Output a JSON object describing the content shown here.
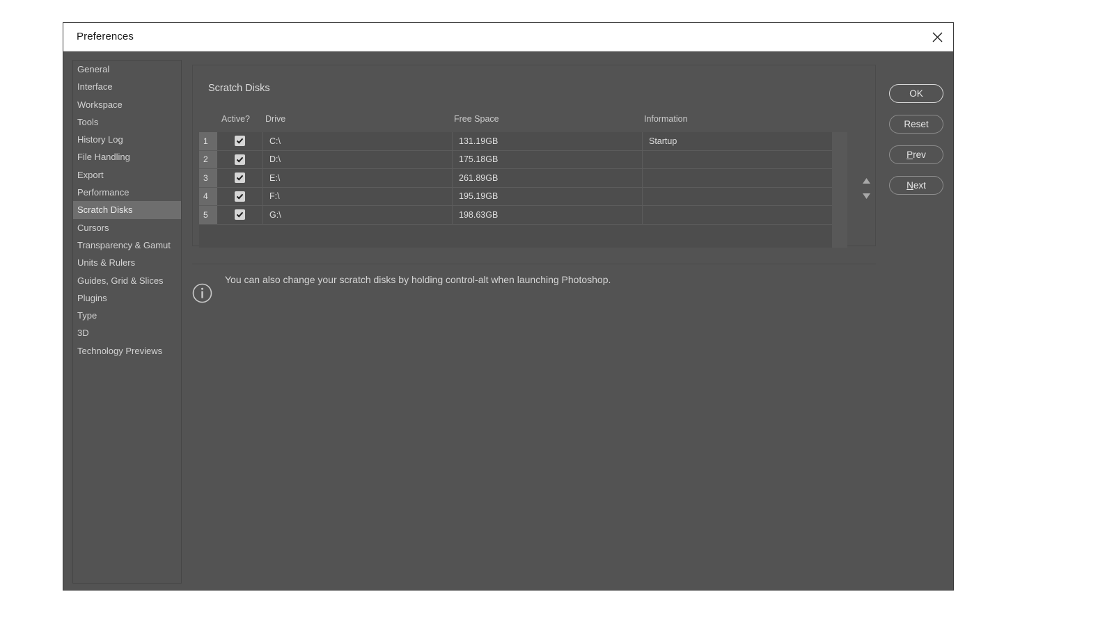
{
  "window": {
    "title": "Preferences",
    "close_icon": "close-icon"
  },
  "sidebar": {
    "items": [
      {
        "label": "General",
        "selected": false
      },
      {
        "label": "Interface",
        "selected": false
      },
      {
        "label": "Workspace",
        "selected": false
      },
      {
        "label": "Tools",
        "selected": false
      },
      {
        "label": "History Log",
        "selected": false
      },
      {
        "label": "File Handling",
        "selected": false
      },
      {
        "label": "Export",
        "selected": false
      },
      {
        "label": "Performance",
        "selected": false
      },
      {
        "label": "Scratch Disks",
        "selected": true
      },
      {
        "label": "Cursors",
        "selected": false
      },
      {
        "label": "Transparency & Gamut",
        "selected": false
      },
      {
        "label": "Units & Rulers",
        "selected": false
      },
      {
        "label": "Guides, Grid & Slices",
        "selected": false
      },
      {
        "label": "Plugins",
        "selected": false
      },
      {
        "label": "Type",
        "selected": false
      },
      {
        "label": "3D",
        "selected": false
      },
      {
        "label": "Technology Previews",
        "selected": false
      }
    ]
  },
  "panel": {
    "group_title": "Scratch Disks",
    "columns": {
      "active": "Active?",
      "drive": "Drive",
      "free_space": "Free Space",
      "information": "Information"
    },
    "rows": [
      {
        "index": "1",
        "active": true,
        "drive": "C:\\",
        "free_space": "131.19GB",
        "information": "Startup"
      },
      {
        "index": "2",
        "active": true,
        "drive": "D:\\",
        "free_space": "175.18GB",
        "information": ""
      },
      {
        "index": "3",
        "active": true,
        "drive": "E:\\",
        "free_space": "261.89GB",
        "information": ""
      },
      {
        "index": "4",
        "active": true,
        "drive": "F:\\",
        "free_space": "195.19GB",
        "information": ""
      },
      {
        "index": "5",
        "active": true,
        "drive": "G:\\",
        "free_space": "198.63GB",
        "information": ""
      }
    ],
    "reorder": {
      "up_icon": "arrow-up-icon",
      "down_icon": "arrow-down-icon"
    },
    "note": {
      "icon": "info-icon",
      "text": "You can also change your scratch disks by holding control-alt when launching Photoshop."
    }
  },
  "buttons": {
    "ok": "OK",
    "reset": "Reset",
    "prev_accel": "P",
    "prev_rest": "rev",
    "next_accel": "N",
    "next_rest": "ext"
  },
  "colors": {
    "dialog_bg": "#535353",
    "titlebar_bg": "#ffffff",
    "table_bg": "#4d4d4d",
    "row_index_bg": "#6a6a6a",
    "selection_bg": "#6e6e6e",
    "text": "#d6d6d6"
  }
}
